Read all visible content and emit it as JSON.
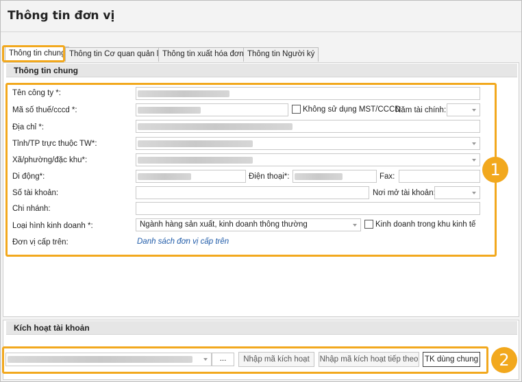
{
  "window": {
    "title": "Thông tin đơn vị"
  },
  "tabs": [
    {
      "label": "Thông tin chung",
      "active": true
    },
    {
      "label": "Thông tin Cơ quan quản lý"
    },
    {
      "label": "Thông tin xuất hóa đơn"
    },
    {
      "label": "Thông tin Người ký"
    }
  ],
  "general": {
    "header": "Thông tin chung",
    "company_name_label": "Tên công ty *:",
    "tax_code_label": "Mã số thuế/cccd *:",
    "no_tax_code_label": "Không sử dụng MST/CCCD",
    "fiscal_year_label": "Năm tài chính:",
    "address_label": "Địa chỉ *:",
    "province_label": "Tỉnh/TP trực thuộc TW*:",
    "ward_label": "Xã/phường/đặc khu*:",
    "mobile_label": "Di động*:",
    "phone_label": "Điện thoại*:",
    "fax_label": "Fax:",
    "account_no_label": "Số tài khoản:",
    "bank_label": "Nơi mở tài khoản:",
    "branch_label": "Chi nhánh:",
    "business_type_label": "Loại hình kinh doanh *:",
    "business_type_value": "Ngành hàng sản xuất, kinh doanh thông thường",
    "economic_zone_label": "Kinh doanh trong khu kinh tế",
    "parent_unit_label": "Đơn vị cấp trên:",
    "parent_unit_link": "Danh sách đơn vị cấp trên"
  },
  "activation": {
    "header": "Kích hoạt tài khoản",
    "ellipsis": "...",
    "enter_code_button": "Nhập mã kích hoạt",
    "enter_next_code_button": "Nhập mã kích hoạt tiếp theo",
    "shared_account_button": "TK dùng chung"
  },
  "callouts": [
    "1",
    "2"
  ],
  "colors": {
    "highlight": "#f2a81d",
    "link": "#1e5aa8"
  }
}
